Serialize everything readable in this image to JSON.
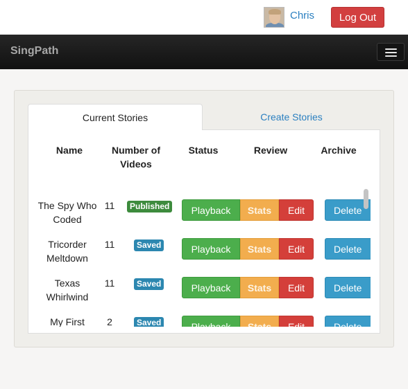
{
  "topbar": {
    "user_name": "Chris",
    "logout_label": "Log Out"
  },
  "navbar": {
    "brand": "SingPath"
  },
  "tabs": {
    "current": "Current Stories",
    "create": "Create Stories"
  },
  "table": {
    "headers": {
      "name": "Name",
      "videos": "Number of\nVideos",
      "status": "Status",
      "review": "Review",
      "archive": "Archive"
    },
    "buttons": {
      "playback": "Playback",
      "stats": "Stats",
      "edit": "Edit",
      "delete": "Delete"
    },
    "rows": [
      {
        "name": "The Spy Who Coded",
        "videos": "11",
        "status": "Published"
      },
      {
        "name": "Tricorder Meltdown",
        "videos": "11",
        "status": "Saved"
      },
      {
        "name": "Texas Whirlwind",
        "videos": "11",
        "status": "Saved"
      },
      {
        "name": "My First",
        "videos": "2",
        "status": "Saved"
      }
    ]
  },
  "colors": {
    "published": "#3d8b3d",
    "saved": "#2c87b0",
    "playback": "#4cae4c",
    "stats": "#f2ad4e",
    "edit": "#d43f3a",
    "delete": "#3a9cc9",
    "logout": "#d23f3f",
    "link": "#2a7fc0"
  }
}
